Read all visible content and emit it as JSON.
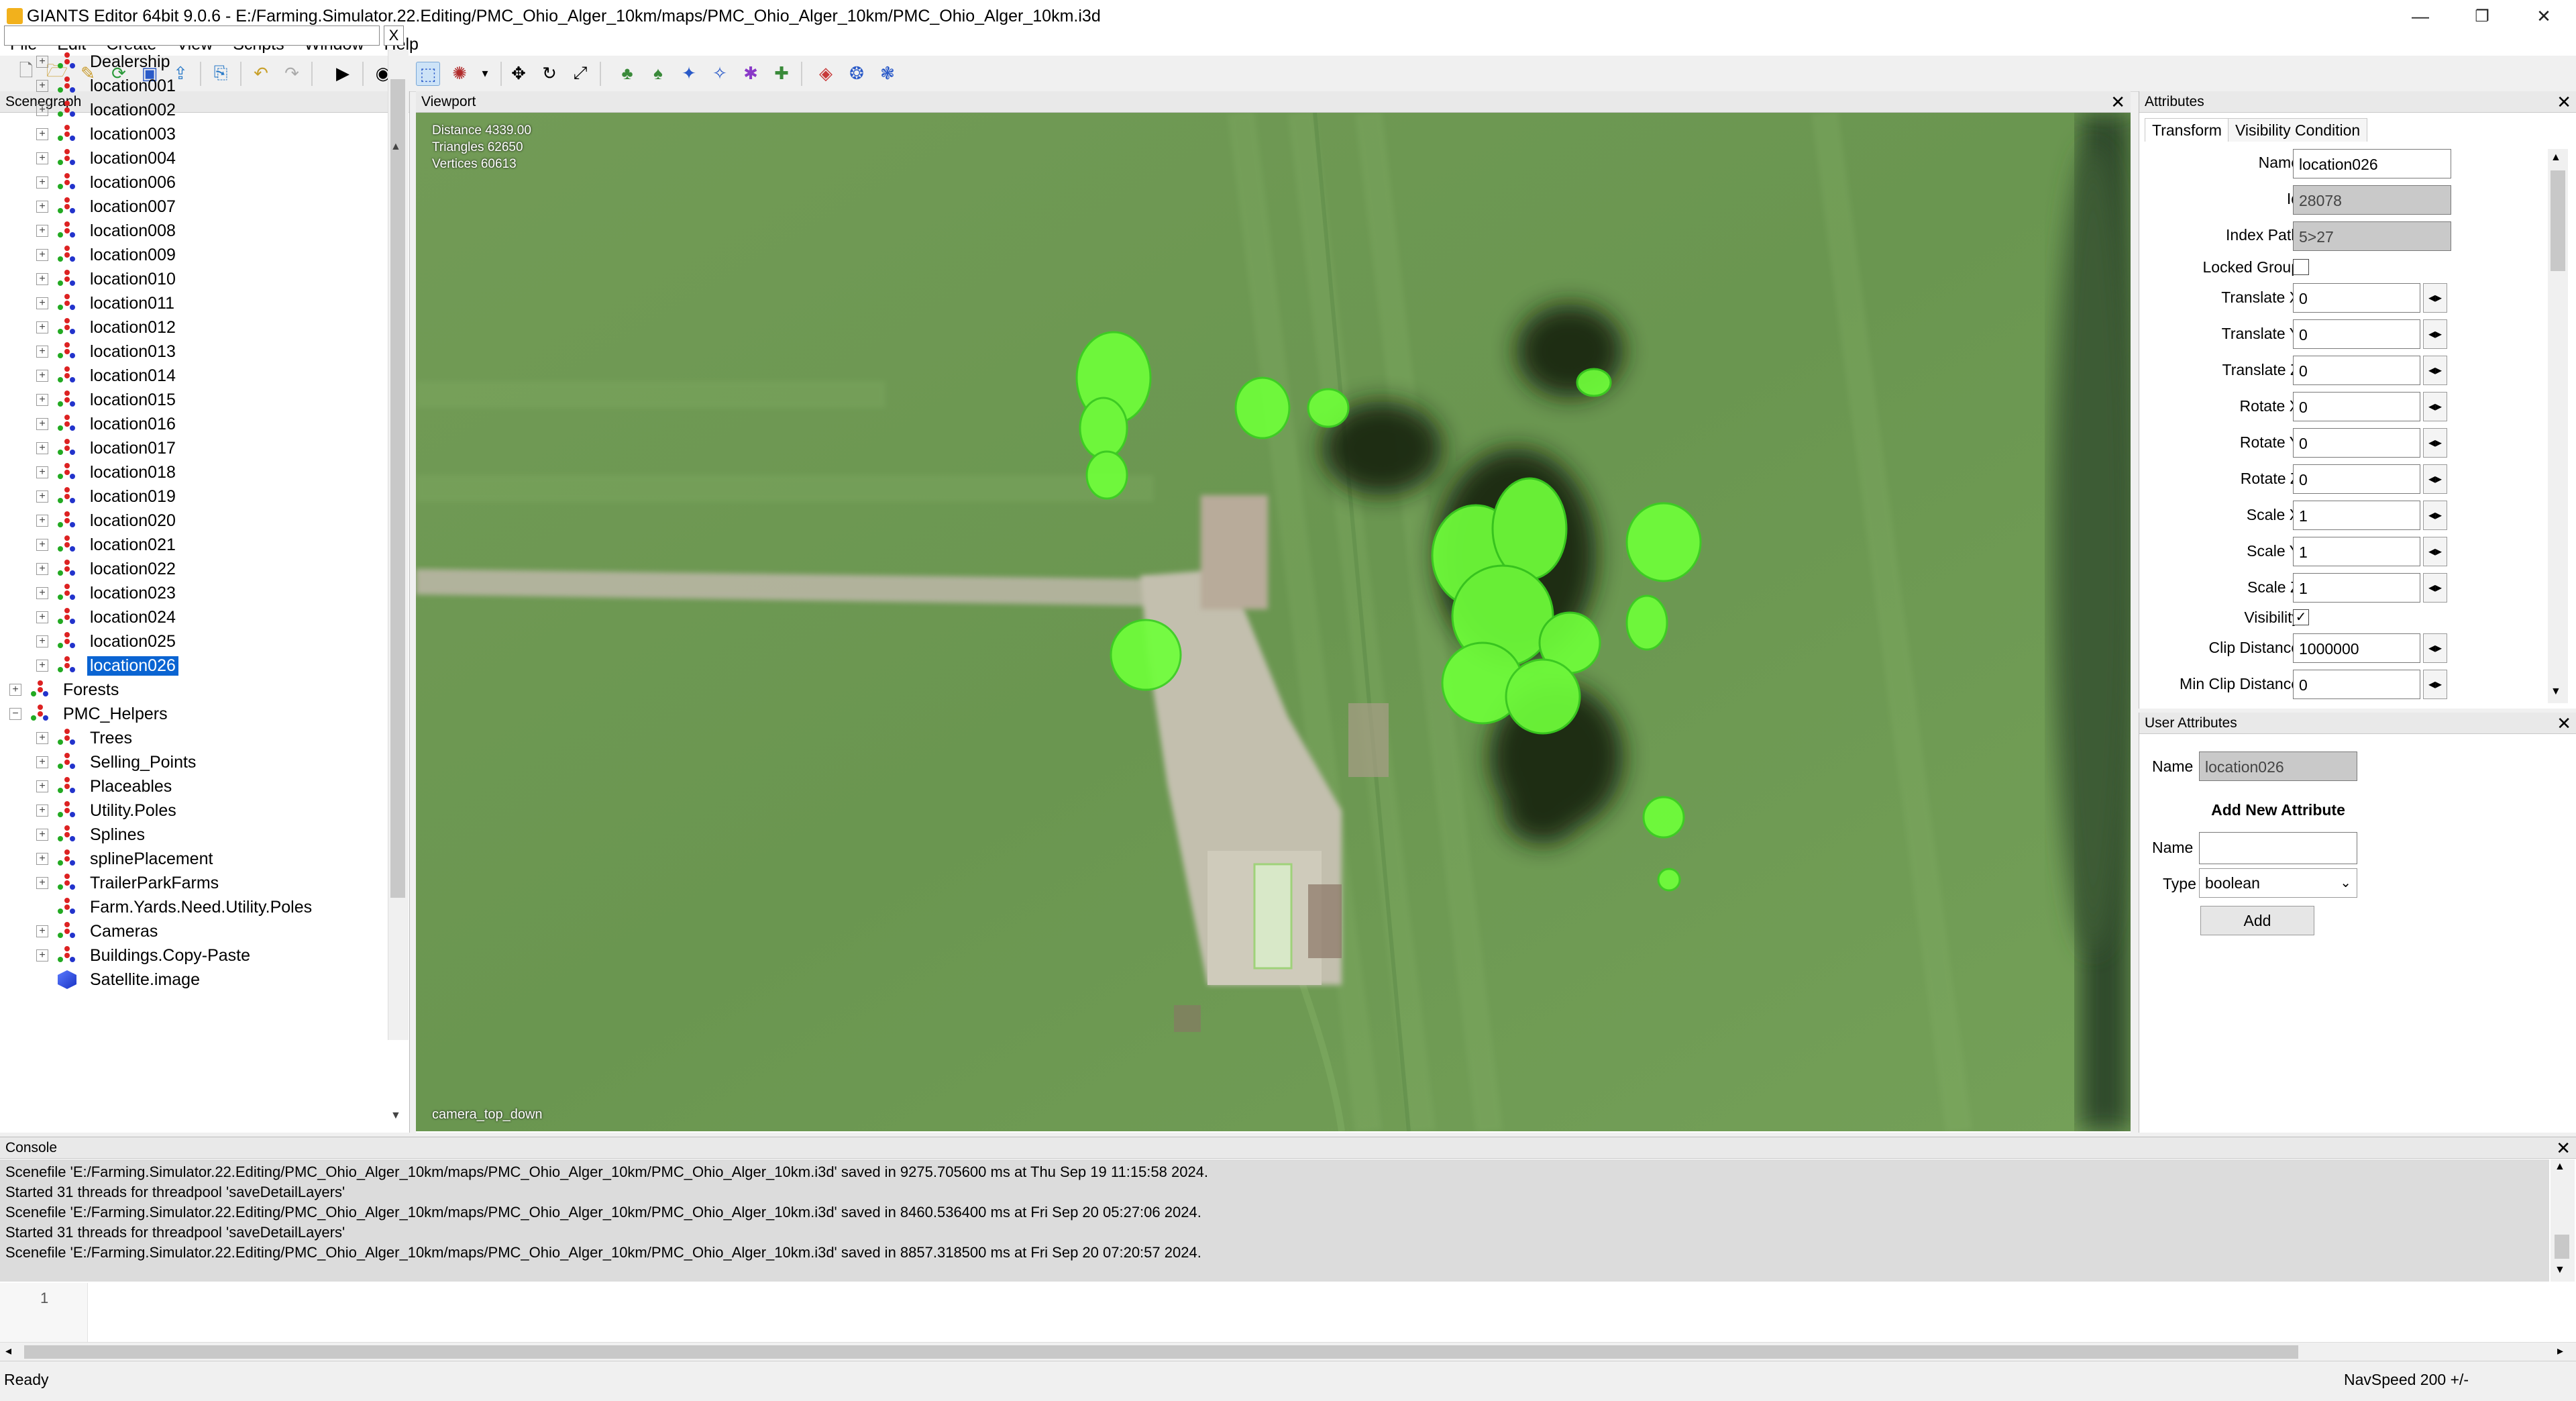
{
  "window": {
    "title": "GIANTS Editor 64bit 9.0.6 - E:/Farming.Simulator.22.Editing/PMC_Ohio_Alger_10km/maps/PMC_Ohio_Alger_10km/PMC_Ohio_Alger_10km.i3d",
    "minimize": "—",
    "restore": "❐",
    "close": "✕"
  },
  "menu": [
    "File",
    "Edit",
    "Create",
    "View",
    "Scripts",
    "Window",
    "Help"
  ],
  "toolbar_icons": [
    "new-file-icon",
    "open-file-icon",
    "edit-file-icon",
    "refresh-icon",
    "save-icon",
    "export-icon",
    "import-icon",
    "undo-icon",
    "redo-icon",
    "play-icon",
    "eye-icon",
    "select-mode-icon",
    "terrain-brush-icon",
    "dropdown-arrow-icon",
    "move-icon",
    "rotate-icon",
    "scale-icon",
    "tool1-icon",
    "tool2-icon",
    "tool3-icon",
    "tool4-icon",
    "tool5-icon",
    "tool6-icon",
    "tool7-icon",
    "tool8-icon",
    "tool9-icon"
  ],
  "scenegraph": {
    "title": "Scenegraph",
    "close": "✕",
    "search_clear": "X",
    "nodes": [
      {
        "label": "Dealership",
        "level": 1,
        "type": "tg",
        "expander": "+"
      },
      {
        "label": "location001",
        "level": 1,
        "type": "tg",
        "expander": "+"
      },
      {
        "label": "location002",
        "level": 1,
        "type": "tg",
        "expander": "+"
      },
      {
        "label": "location003",
        "level": 1,
        "type": "tg",
        "expander": "+"
      },
      {
        "label": "location004",
        "level": 1,
        "type": "tg",
        "expander": "+"
      },
      {
        "label": "location006",
        "level": 1,
        "type": "tg",
        "expander": "+"
      },
      {
        "label": "location007",
        "level": 1,
        "type": "tg",
        "expander": "+"
      },
      {
        "label": "location008",
        "level": 1,
        "type": "tg",
        "expander": "+"
      },
      {
        "label": "location009",
        "level": 1,
        "type": "tg",
        "expander": "+"
      },
      {
        "label": "location010",
        "level": 1,
        "type": "tg",
        "expander": "+"
      },
      {
        "label": "location011",
        "level": 1,
        "type": "tg",
        "expander": "+"
      },
      {
        "label": "location012",
        "level": 1,
        "type": "tg",
        "expander": "+"
      },
      {
        "label": "location013",
        "level": 1,
        "type": "tg",
        "expander": "+"
      },
      {
        "label": "location014",
        "level": 1,
        "type": "tg",
        "expander": "+"
      },
      {
        "label": "location015",
        "level": 1,
        "type": "tg",
        "expander": "+"
      },
      {
        "label": "location016",
        "level": 1,
        "type": "tg",
        "expander": "+"
      },
      {
        "label": "location017",
        "level": 1,
        "type": "tg",
        "expander": "+"
      },
      {
        "label": "location018",
        "level": 1,
        "type": "tg",
        "expander": "+"
      },
      {
        "label": "location019",
        "level": 1,
        "type": "tg",
        "expander": "+"
      },
      {
        "label": "location020",
        "level": 1,
        "type": "tg",
        "expander": "+"
      },
      {
        "label": "location021",
        "level": 1,
        "type": "tg",
        "expander": "+"
      },
      {
        "label": "location022",
        "level": 1,
        "type": "tg",
        "expander": "+"
      },
      {
        "label": "location023",
        "level": 1,
        "type": "tg",
        "expander": "+"
      },
      {
        "label": "location024",
        "level": 1,
        "type": "tg",
        "expander": "+"
      },
      {
        "label": "location025",
        "level": 1,
        "type": "tg",
        "expander": "+"
      },
      {
        "label": "location026",
        "level": 1,
        "type": "tg",
        "expander": "+",
        "selected": true
      },
      {
        "label": "Forests",
        "level": 0,
        "type": "tg",
        "expander": "+"
      },
      {
        "label": "PMC_Helpers",
        "level": 0,
        "type": "tg",
        "expander": "−"
      },
      {
        "label": "Trees",
        "level": 1,
        "type": "tg",
        "expander": "+"
      },
      {
        "label": "Selling_Points",
        "level": 1,
        "type": "tg",
        "expander": "+"
      },
      {
        "label": "Placeables",
        "level": 1,
        "type": "tg",
        "expander": "+"
      },
      {
        "label": "Utility.Poles",
        "level": 1,
        "type": "tg",
        "expander": "+"
      },
      {
        "label": "Splines",
        "level": 1,
        "type": "tg",
        "expander": "+"
      },
      {
        "label": "splinePlacement",
        "level": 1,
        "type": "tg",
        "expander": "+"
      },
      {
        "label": "TrailerParkFarms",
        "level": 1,
        "type": "tg",
        "expander": "+"
      },
      {
        "label": "Farm.Yards.Need.Utility.Poles",
        "level": 1,
        "type": "tg",
        "expander": ""
      },
      {
        "label": "Cameras",
        "level": 1,
        "type": "tg",
        "expander": "+"
      },
      {
        "label": "Buildings.Copy-Paste",
        "level": 1,
        "type": "tg",
        "expander": "+"
      },
      {
        "label": "Satellite.image",
        "level": 1,
        "type": "shape",
        "expander": ""
      }
    ]
  },
  "viewport": {
    "title": "Viewport",
    "close": "✕",
    "stats": [
      "Distance 4339.00",
      "Triangles 62650",
      "Vertices 60613"
    ],
    "camera": "camera_top_down"
  },
  "attributes": {
    "title": "Attributes",
    "close": "✕",
    "tabs": [
      "Transform",
      "Visibility Condition"
    ],
    "fields": {
      "name": {
        "label": "Name",
        "value": "location026"
      },
      "id": {
        "label": "Id",
        "value": "28078"
      },
      "index_path": {
        "label": "Index Path",
        "value": "5>27"
      },
      "locked_group": {
        "label": "Locked Group",
        "checked": ""
      },
      "translate_x": {
        "label": "Translate X",
        "value": "0"
      },
      "translate_y": {
        "label": "Translate Y",
        "value": "0"
      },
      "translate_z": {
        "label": "Translate Z",
        "value": "0"
      },
      "rotate_x": {
        "label": "Rotate X",
        "value": "0"
      },
      "rotate_y": {
        "label": "Rotate Y",
        "value": "0"
      },
      "rotate_z": {
        "label": "Rotate Z",
        "value": "0"
      },
      "scale_x": {
        "label": "Scale X",
        "value": "1"
      },
      "scale_y": {
        "label": "Scale Y",
        "value": "1"
      },
      "scale_z": {
        "label": "Scale Z",
        "value": "1"
      },
      "visibility": {
        "label": "Visibility",
        "checked": "✓"
      },
      "clip_distance": {
        "label": "Clip Distance",
        "value": "1000000"
      },
      "min_clip_distance": {
        "label": "Min Clip Distance",
        "value": "0"
      }
    },
    "spin_glyph": "◂▸"
  },
  "user_attributes": {
    "title": "User Attributes",
    "close": "✕",
    "name_label": "Name",
    "name_value": "location026",
    "add_new_heading": "Add New Attribute",
    "new_name_label": "Name",
    "new_name_value": "",
    "type_label": "Type",
    "type_value": "boolean",
    "add_button": "Add"
  },
  "console": {
    "title": "Console",
    "close": "✕",
    "lines": [
      "Scenefile 'E:/Farming.Simulator.22.Editing/PMC_Ohio_Alger_10km/maps/PMC_Ohio_Alger_10km/PMC_Ohio_Alger_10km.i3d' saved in 9275.705600 ms at Thu Sep 19 11:15:58 2024.",
      "Started 31 threads for threadpool 'saveDetailLayers'",
      "Scenefile 'E:/Farming.Simulator.22.Editing/PMC_Ohio_Alger_10km/maps/PMC_Ohio_Alger_10km/PMC_Ohio_Alger_10km.i3d' saved in 8460.536400 ms at Fri Sep 20 05:27:06 2024.",
      "Started 31 threads for threadpool 'saveDetailLayers'",
      "Scenefile 'E:/Farming.Simulator.22.Editing/PMC_Ohio_Alger_10km/maps/PMC_Ohio_Alger_10km/PMC_Ohio_Alger_10km.i3d' saved in 8857.318500 ms at Fri Sep 20 07:20:57 2024."
    ],
    "input_line_number": "1",
    "input_value": ""
  },
  "statusbar": {
    "status": "Ready",
    "navspeed": "NavSpeed 200 +/-"
  },
  "colors": {
    "selection": "#0a64d2",
    "grass": "#6f9a52",
    "tree_highlight": "#6fff3a"
  }
}
